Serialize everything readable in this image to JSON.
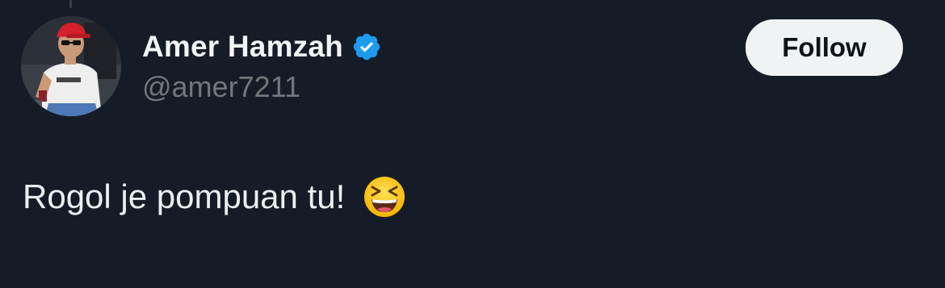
{
  "author": {
    "display_name": "Amer Hamzah",
    "handle": "@amer7211",
    "verified": true,
    "avatar_icon": "profile-photo"
  },
  "actions": {
    "follow_label": "Follow"
  },
  "tweet": {
    "text": "Rogol je pompuan tu!",
    "emoji_icon": "laughing-squinting-face-emoji"
  },
  "colors": {
    "background": "#161c27",
    "verified_badge": "#1d9bf0",
    "handle_text": "#73777c",
    "follow_button_bg": "#eff3f4"
  }
}
